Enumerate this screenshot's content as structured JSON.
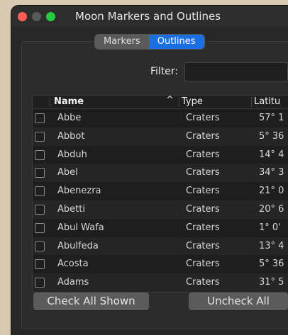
{
  "window": {
    "title": "Moon Markers and Outlines"
  },
  "tabs": [
    {
      "label": "Markers",
      "active": false
    },
    {
      "label": "Outlines",
      "active": true
    }
  ],
  "filter": {
    "label": "Filter:",
    "value": ""
  },
  "table": {
    "columns": {
      "name": "Name",
      "type": "Type",
      "latitude": "Latitu"
    },
    "sort": {
      "column": "Name",
      "indicator": "^"
    },
    "rows": [
      {
        "name": "Abbe",
        "type": "Craters",
        "lat": "57° 1"
      },
      {
        "name": "Abbot",
        "type": "Craters",
        "lat": "5° 36"
      },
      {
        "name": "Abduh",
        "type": "Craters",
        "lat": "14° 4"
      },
      {
        "name": "Abel",
        "type": "Craters",
        "lat": "34° 3"
      },
      {
        "name": "Abenezra",
        "type": "Craters",
        "lat": "21° 0"
      },
      {
        "name": "Abetti",
        "type": "Craters",
        "lat": "20° 6"
      },
      {
        "name": "Abul Wafa",
        "type": "Craters",
        "lat": "1° 0'"
      },
      {
        "name": "Abulfeda",
        "type": "Craters",
        "lat": "13° 4"
      },
      {
        "name": "Acosta",
        "type": "Craters",
        "lat": "5° 36"
      },
      {
        "name": "Adams",
        "type": "Craters",
        "lat": "31° 5"
      }
    ]
  },
  "buttons": {
    "check_all": "Check All Shown",
    "uncheck_all": "Uncheck All"
  },
  "colors": {
    "accent": "#1a6fe3",
    "close": "#ff5f57",
    "zoom": "#28c840"
  }
}
